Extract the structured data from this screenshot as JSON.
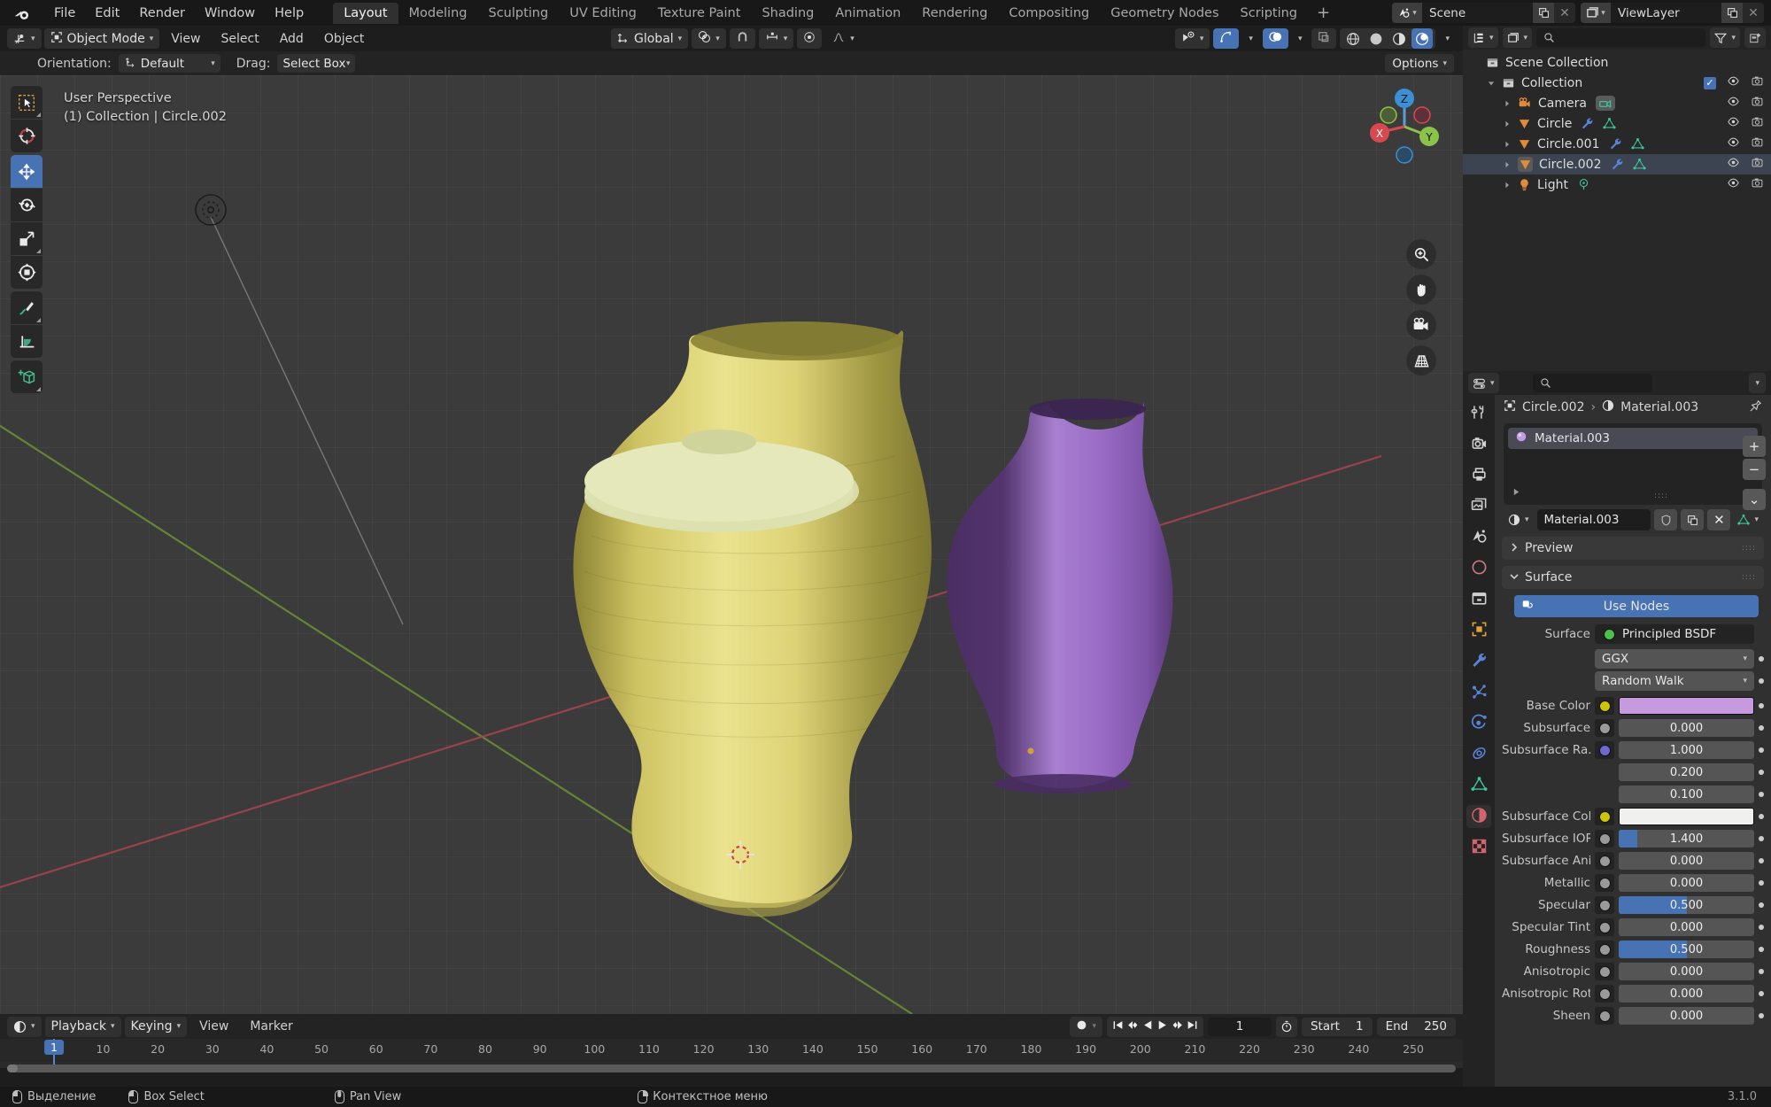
{
  "topbar": {
    "logo_icon": "blender-logo-icon",
    "menus": [
      "File",
      "Edit",
      "Render",
      "Window",
      "Help"
    ],
    "workspaces": [
      {
        "label": "Layout",
        "active": true
      },
      {
        "label": "Modeling",
        "active": false
      },
      {
        "label": "Sculpting",
        "active": false
      },
      {
        "label": "UV Editing",
        "active": false
      },
      {
        "label": "Texture Paint",
        "active": false
      },
      {
        "label": "Shading",
        "active": false
      },
      {
        "label": "Animation",
        "active": false
      },
      {
        "label": "Rendering",
        "active": false
      },
      {
        "label": "Compositing",
        "active": false
      },
      {
        "label": "Geometry Nodes",
        "active": false
      },
      {
        "label": "Scripting",
        "active": false
      }
    ],
    "add_workspace": "+",
    "scene": {
      "icon": "scene-icon",
      "value": "Scene",
      "copy_icon": "duplicate-icon",
      "close_icon": "close-icon"
    },
    "viewlayer": {
      "icon": "viewlayer-icon",
      "value": "ViewLayer",
      "copy_icon": "duplicate-icon",
      "close_icon": "close-icon"
    }
  },
  "viewport_header": {
    "editor_type_icon": "editor-type-3dview-icon",
    "mode": "Object Mode",
    "mode_icon": "object-mode-icon",
    "menus": [
      "View",
      "Select",
      "Add",
      "Object"
    ],
    "transform_orientation": "Global",
    "orientation_icon": "orientation-axis-icon",
    "snap_magnet_icon": "magnet-icon",
    "snap_to_icon": "snap-increment-icon",
    "pivot_icon": "pivot-median-icon",
    "proportional_icon": "proportional-falloff-icon",
    "visibility_icon": "object-visibility-icon",
    "gizmo_icon": "gizmo-icon",
    "overlays_icon": "overlays-icon",
    "xray_icon": "xray-icon",
    "shading_modes": [
      "wireframe",
      "solid",
      "material-preview",
      "rendered"
    ],
    "shading_active": "rendered"
  },
  "tool_settings": {
    "orientation_label": "Orientation:",
    "orientation_value": "Default",
    "drag_label": "Drag:",
    "drag_value": "Select Box",
    "options_label": "Options"
  },
  "viewport": {
    "perspective_text": "User Perspective",
    "context_text": "(1) Collection | Circle.002",
    "tools": [
      {
        "name": "tweak-tool",
        "icon": "cursor-select-box-icon",
        "active": false
      },
      {
        "name": "cursor-tool",
        "icon": "3d-cursor-icon",
        "active": false
      },
      {
        "name": "move-tool",
        "icon": "move-arrows-icon",
        "active": true
      },
      {
        "name": "rotate-tool",
        "icon": "rotate-icon",
        "active": false
      },
      {
        "name": "scale-tool",
        "icon": "scale-icon",
        "active": false
      },
      {
        "name": "transform-tool",
        "icon": "transform-icon",
        "active": false
      },
      {
        "name": "annotate-tool",
        "icon": "pencil-icon",
        "active": false
      },
      {
        "name": "measure-tool",
        "icon": "ruler-icon",
        "active": false
      },
      {
        "name": "add-cube-tool",
        "icon": "add-cube-icon",
        "active": false
      }
    ],
    "gizmo_axes": [
      "X",
      "Y",
      "Z"
    ],
    "nav_buttons": [
      "zoom-icon",
      "hand-pan-icon",
      "camera-icon",
      "perspective-grid-icon"
    ]
  },
  "outliner": {
    "display_mode_icon": "outliner-display-mode-icon",
    "filter_id_icon": "filter-id-icon",
    "search_placeholder": "",
    "filter_icon": "funnel-filter-icon",
    "new_collection_icon": "new-collection-icon",
    "rows": [
      {
        "label": "Scene Collection",
        "icon": "scene-collection-icon",
        "indent": 0,
        "expand": "none",
        "selected": false,
        "checkbox": false,
        "eye": false,
        "camera": false,
        "extra": []
      },
      {
        "label": "Collection",
        "icon": "collection-icon",
        "indent": 1,
        "expand": "down",
        "selected": false,
        "checkbox": true,
        "eye": true,
        "camera": true,
        "extra": []
      },
      {
        "label": "Camera",
        "icon": "camera-object-icon",
        "indent": 2,
        "expand": "right",
        "selected": false,
        "checkbox": false,
        "eye": true,
        "camera": true,
        "extra": [
          "camera-data-icon"
        ]
      },
      {
        "label": "Circle",
        "icon": "mesh-object-icon",
        "indent": 2,
        "expand": "right",
        "selected": false,
        "checkbox": false,
        "eye": true,
        "camera": true,
        "extra": [
          "wrench-modifier-icon",
          "mesh-data-icon"
        ]
      },
      {
        "label": "Circle.001",
        "icon": "mesh-object-icon",
        "indent": 2,
        "expand": "right",
        "selected": false,
        "checkbox": false,
        "eye": true,
        "camera": true,
        "extra": [
          "wrench-modifier-icon",
          "mesh-data-icon"
        ]
      },
      {
        "label": "Circle.002",
        "icon": "mesh-object-icon",
        "indent": 2,
        "expand": "right",
        "selected": true,
        "checkbox": false,
        "eye": true,
        "camera": true,
        "extra": [
          "wrench-modifier-icon",
          "mesh-data-icon"
        ]
      },
      {
        "label": "Light",
        "icon": "light-object-icon",
        "indent": 2,
        "expand": "right",
        "selected": false,
        "checkbox": false,
        "eye": true,
        "camera": true,
        "extra": [
          "light-data-icon"
        ]
      }
    ]
  },
  "properties": {
    "editor_icon": "properties-editor-icon",
    "search_placeholder": "",
    "tabs": [
      {
        "name": "tool",
        "icon": "tool-icon",
        "active": false,
        "color": "#c8c8c8"
      },
      {
        "name": "render",
        "icon": "render-camera-icon",
        "active": false,
        "color": "#d0d0d0"
      },
      {
        "name": "output",
        "icon": "printer-output-icon",
        "active": false,
        "color": "#d0d0d0"
      },
      {
        "name": "view-layer",
        "icon": "view-layer-images-icon",
        "active": false,
        "color": "#d0d0d0"
      },
      {
        "name": "scene",
        "icon": "scene-cone-icon",
        "active": false,
        "color": "#d0d0d0"
      },
      {
        "name": "world",
        "icon": "world-globe-icon",
        "active": false,
        "color": "#d17b88"
      },
      {
        "name": "collection",
        "icon": "collection-box-icon",
        "active": false,
        "color": "#d0d0d0"
      },
      {
        "name": "object",
        "icon": "object-square-icon",
        "active": false,
        "color": "#e2a33a"
      },
      {
        "name": "modifiers",
        "icon": "wrench-icon",
        "active": false,
        "color": "#5a82d6"
      },
      {
        "name": "particles",
        "icon": "particles-icon",
        "active": false,
        "color": "#5a82d6"
      },
      {
        "name": "physics",
        "icon": "physics-orbit-icon",
        "active": false,
        "color": "#5a82d6"
      },
      {
        "name": "constraints",
        "icon": "constraints-icon",
        "active": false,
        "color": "#5a82d6"
      },
      {
        "name": "data",
        "icon": "mesh-data-triangle-icon",
        "active": false,
        "color": "#3ec49a"
      },
      {
        "name": "material",
        "icon": "material-sphere-icon",
        "active": true,
        "color": "#d3646f"
      },
      {
        "name": "texture",
        "icon": "texture-checker-icon",
        "active": false,
        "color": "#d3646f"
      }
    ],
    "breadcrumb": {
      "object_icon": "object-square-icon",
      "object": "Circle.002",
      "sep": "›",
      "material_icon": "material-sphere-icon",
      "material": "Material.003",
      "pin_icon": "pin-icon"
    },
    "slot_list": [
      {
        "label": "Material.003",
        "icon": "material-preview-sphere-icon",
        "selected": true
      }
    ],
    "slot_buttons": [
      "+",
      "−",
      "⌄"
    ],
    "id_block": {
      "browse_icon": "browse-material-icon",
      "name": "Material.003",
      "fake_user_icon": "shield-fake-user-icon",
      "copy_icon": "new-material-icon",
      "unlink_icon": "unlink-x-icon",
      "slot_link_icon": "mesh-data-icon"
    },
    "panels": [
      {
        "label": "Preview",
        "open": false
      },
      {
        "label": "Surface",
        "open": true
      }
    ],
    "use_nodes_label": "Use Nodes",
    "use_nodes_icon": "nodes-icon",
    "surface_label": "Surface",
    "surface_value": "Principled BSDF",
    "distribution": "GGX",
    "subsurface_method": "Random Walk",
    "inputs": [
      {
        "label": "Base Color",
        "type": "color",
        "value": "#c79ae0",
        "socket": "#ccc306"
      },
      {
        "label": "Subsurface",
        "type": "number",
        "value": "0.000",
        "fill": 0,
        "socket": "#9a9a9a"
      },
      {
        "label": "Subsurface Ra...",
        "type": "vector",
        "values": [
          "1.000",
          "0.200",
          "0.100"
        ],
        "socket": "#6a6ad0"
      },
      {
        "label": "Subsurface Col...",
        "type": "color",
        "value": "#f0f0ee",
        "socket": "#ccc306"
      },
      {
        "label": "Subsurface IOR",
        "type": "number",
        "value": "1.400",
        "fill": 14,
        "socket": "#9a9a9a"
      },
      {
        "label": "Subsurface Ani...",
        "type": "number",
        "value": "0.000",
        "fill": 0,
        "socket": "#9a9a9a"
      },
      {
        "label": "Metallic",
        "type": "number",
        "value": "0.000",
        "fill": 0,
        "socket": "#9a9a9a"
      },
      {
        "label": "Specular",
        "type": "number",
        "value": "0.500",
        "fill": 50,
        "socket": "#9a9a9a"
      },
      {
        "label": "Specular Tint",
        "type": "number",
        "value": "0.000",
        "fill": 0,
        "socket": "#9a9a9a"
      },
      {
        "label": "Roughness",
        "type": "number",
        "value": "0.500",
        "fill": 50,
        "socket": "#9a9a9a"
      },
      {
        "label": "Anisotropic",
        "type": "number",
        "value": "0.000",
        "fill": 0,
        "socket": "#9a9a9a"
      },
      {
        "label": "Anisotropic Rot...",
        "type": "number",
        "value": "0.000",
        "fill": 0,
        "socket": "#9a9a9a"
      },
      {
        "label": "Sheen",
        "type": "number",
        "value": "0.000",
        "fill": 0,
        "socket": "#9a9a9a"
      }
    ]
  },
  "timeline": {
    "editor_icon": "timeline-editor-icon",
    "menus": [
      "Playback",
      "Keying",
      "View",
      "Marker"
    ],
    "auto_key_icon": "record-keyframe-icon",
    "transport": [
      "jump-start-icon",
      "prev-keyframe-icon",
      "play-reverse-icon",
      "play-icon",
      "next-keyframe-icon",
      "jump-end-icon"
    ],
    "current_frame": "1",
    "stopwatch_icon": "stopwatch-icon",
    "start_label": "Start",
    "start_value": "1",
    "end_label": "End",
    "end_value": "250",
    "ticks": [
      1,
      10,
      20,
      30,
      40,
      50,
      60,
      70,
      80,
      90,
      100,
      110,
      120,
      130,
      140,
      150,
      160,
      170,
      180,
      190,
      200,
      210,
      220,
      230,
      240,
      250
    ],
    "playhead_frame": 1
  },
  "statusbar": {
    "items": [
      {
        "icon": "mouse-left-icon",
        "label": "Выделение"
      },
      {
        "icon": "mouse-left-drag-icon",
        "label": "Box Select"
      },
      {
        "icon": "mouse-middle-icon",
        "label": "Pan View"
      },
      {
        "icon": "mouse-right-icon",
        "label": "Контекстное меню"
      }
    ],
    "version": "3.1.0"
  },
  "colors": {
    "accent_blue": "#4772b3",
    "vase_yellow": "#d9d06a",
    "vase_purple": "#9a6fc4",
    "axis_x_red": "#b54a52",
    "axis_y_green": "#7aa33a"
  }
}
